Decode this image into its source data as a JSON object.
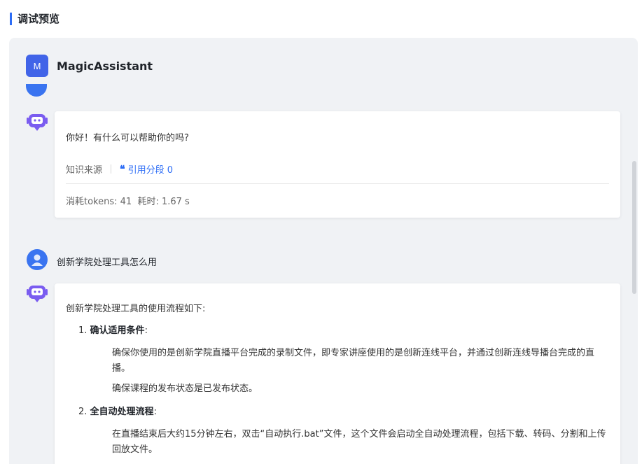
{
  "section": {
    "title": "调试预览"
  },
  "app": {
    "avatar_letter": "M",
    "name": "MagicAssistant"
  },
  "messages": {
    "bot1": {
      "text": "你好！有什么可以帮助你的吗?",
      "source_label": "知识来源",
      "cite_label": "引用分段 0",
      "tokens": "消耗tokens: 41  耗时: 1.67 s"
    },
    "user": {
      "text": "创新学院处理工具怎么用"
    },
    "bot2": {
      "intro": "创新学院处理工具的使用流程如下:",
      "steps": [
        {
          "num": "1.",
          "title": "确认适用条件",
          "colon": ":",
          "items": [
            "确保你使用的是创新学院直播平台完成的录制文件，即专家讲座使用的是创新连线平台，并通过创新连线导播台完成的直播。",
            "确保课程的发布状态是已发布状态。"
          ]
        },
        {
          "num": "2.",
          "title": "全自动处理流程",
          "colon": ":",
          "items": [
            "在直播结束后大约15分钟左右，双击“自动执行.bat”文件，这个文件会启动全自动处理流程，包括下载、转码、分割和上传回放文件。"
          ]
        }
      ]
    }
  },
  "colors": {
    "accent": "#2d6df6",
    "avatar": "#4164e8",
    "bot_icon": "#7a5cf0"
  }
}
